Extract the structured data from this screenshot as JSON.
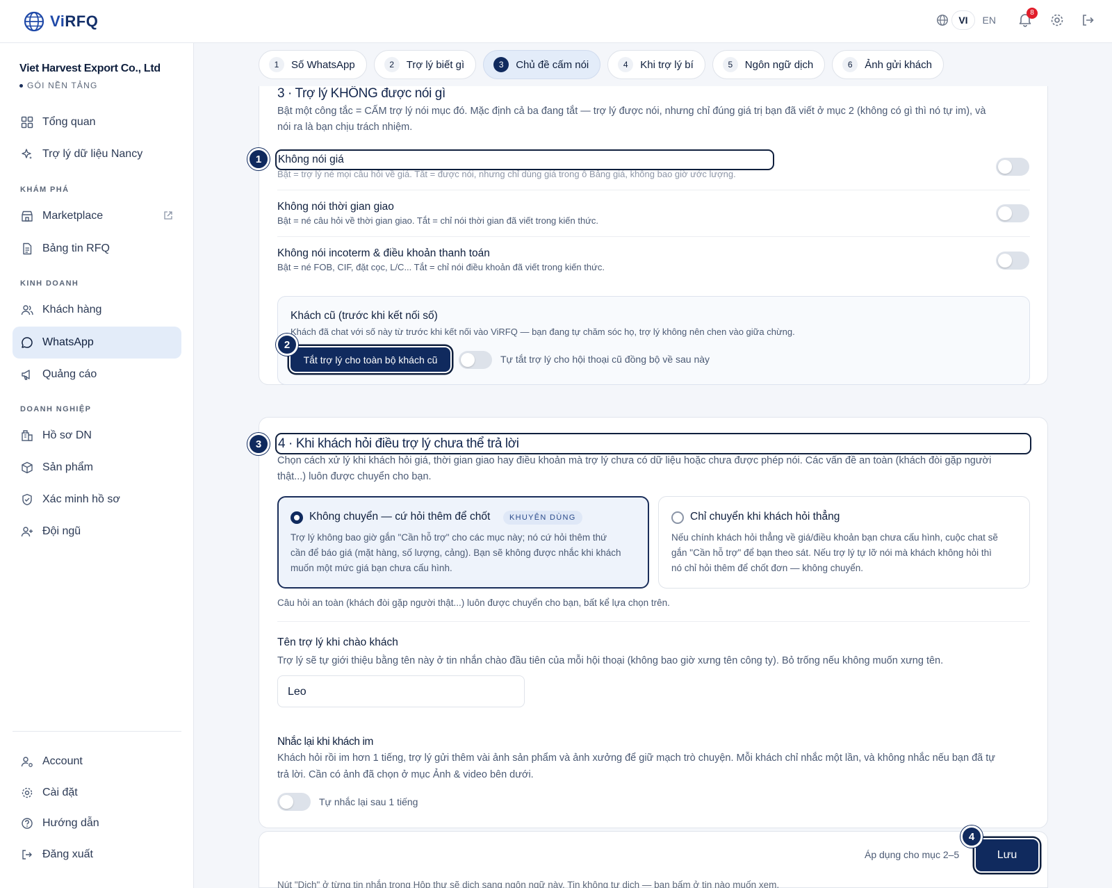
{
  "app": {
    "logo_text": "ViRFQ",
    "logo_accent": "Vi",
    "logo_rest": "RFQ"
  },
  "topbar": {
    "lang_vi": "VI",
    "lang_en": "EN",
    "notifications_count": "8"
  },
  "sidebar": {
    "company": "Viet Harvest Export Co., Ltd",
    "plan": "GÓI NỀN TẢNG",
    "items": [
      {
        "label": "Tổng quan"
      },
      {
        "label": "Trợ lý dữ liệu Nancy"
      },
      {
        "label": "Marketplace"
      },
      {
        "label": "Bảng tin RFQ"
      },
      {
        "label": "Khách hàng"
      },
      {
        "label": "WhatsApp"
      },
      {
        "label": "Quảng cáo"
      },
      {
        "label": "Hồ sơ DN"
      },
      {
        "label": "Sản phẩm"
      },
      {
        "label": "Xác minh hồ sơ"
      },
      {
        "label": "Đội ngũ"
      }
    ],
    "sections": {
      "explore": "KHÁM PHÁ",
      "business": "KINH DOANH",
      "enterprise": "DOANH NGHIỆP"
    },
    "bottom": [
      {
        "label": "Account"
      },
      {
        "label": "Cài đặt"
      },
      {
        "label": "Hướng dẫn"
      },
      {
        "label": "Đăng xuất"
      }
    ]
  },
  "tabs": [
    {
      "num": "1",
      "label": "Số WhatsApp"
    },
    {
      "num": "2",
      "label": "Trợ lý biết gì"
    },
    {
      "num": "3",
      "label": "Chủ đề cấm nói"
    },
    {
      "num": "4",
      "label": "Khi trợ lý bí"
    },
    {
      "num": "5",
      "label": "Ngôn ngữ dịch"
    },
    {
      "num": "6",
      "label": "Ảnh gửi khách"
    }
  ],
  "section3": {
    "title": "3 · Trợ lý KHÔNG được nói gì",
    "desc_line1": "Bật một công tắc = CẤM trợ lý nói mục đó. Mặc định cả ba đang tắt — trợ lý được nói, nhưng chỉ đúng giá trị bạn đã viết ở mục 2 (không có gì thì nó tự im), và",
    "desc_line2": "nói ra là bạn chịu trách nhiệm.",
    "rows": [
      {
        "title": "Không nói giá",
        "sub": "Bật = trợ lý né mọi câu hỏi về giá. Tắt = được nói, nhưng chỉ dùng giá trong ô Bảng giá, không bao giờ ước lượng."
      },
      {
        "title": "Không nói thời gian giao",
        "sub": "Bật = né câu hỏi về thời gian giao. Tắt = chỉ nói thời gian đã viết trong kiến thức."
      },
      {
        "title": "Không nói incoterm & điều khoản thanh toán",
        "sub": "Bật = né FOB, CIF, đặt cọc, L/C... Tắt = chỉ nói điều khoản đã viết trong kiến thức."
      }
    ],
    "old_customers": {
      "title": "Khách cũ (trước khi kết nối số)",
      "desc": "Khách đã chat với số này từ trước khi kết nối vào ViRFQ — bạn đang tự chăm sóc họ, trợ lý không nên chen vào giữa chừng.",
      "button": "Tắt trợ lý cho toàn bộ khách cũ",
      "toggle_label": "Tự tắt trợ lý cho hội thoại cũ đồng bộ về sau này"
    }
  },
  "section4": {
    "title": "4 · Khi khách hỏi điều trợ lý chưa thể trả lời",
    "desc_line1": "Chọn cách xử lý khi khách hỏi giá, thời gian giao hay điều khoản mà trợ lý chưa có dữ liệu hoặc chưa được phép nói. Các vấn đề an toàn (khách đòi gặp người",
    "desc_line2": "thật...) luôn được chuyển cho bạn.",
    "option1": {
      "title": "Không chuyển — cứ hỏi thêm để chốt",
      "badge": "KHUYÊN DÙNG",
      "desc_line1": "Trợ lý không bao giờ gắn \"Cần hỗ trợ\" cho các mục này; nó cứ hỏi thêm thứ",
      "desc_line2": "cần để báo giá (mặt hàng, số lượng, cảng). Bạn sẽ không được nhắc khi khách",
      "desc_line3": "muốn một mức giá bạn chưa cấu hình."
    },
    "option2": {
      "title": "Chỉ chuyển khi khách hỏi thẳng",
      "desc_line1": "Nếu chính khách hỏi thẳng về giá/điều khoản bạn chưa cấu hình, cuộc chat sẽ",
      "desc_line2": "gắn \"Cần hỗ trợ\" để bạn theo sát. Nếu trợ lý tự lỡ nói mà khách không hỏi thì",
      "desc_line3": "nó chỉ hỏi thêm để chốt đơn — không chuyển."
    },
    "note": "Câu hỏi an toàn (khách đòi gặp người thật...) luôn được chuyển cho bạn, bất kể lựa chọn trên.",
    "assistant_name": {
      "title": "Tên trợ lý khi chào khách",
      "desc": "Trợ lý sẽ tự giới thiệu bằng tên này ở tin nhắn chào đầu tiên của mỗi hội thoại (không bao giờ xưng tên công ty). Bỏ trống nếu không muốn xưng tên.",
      "value": "Leo"
    },
    "reminder": {
      "title": "Nhắc lại khi khách im",
      "desc_line1": "Khách hỏi rồi im hơn 1 tiếng, trợ lý gửi thêm vài ảnh sản phẩm và ảnh xưởng để giữ mạch trò chuyện. Mỗi khách chỉ nhắc một lần, và không nhắc nếu bạn đã tự",
      "desc_line2": "trả lời. Cần có ảnh đã chọn ở mục Ảnh & video bên dưới.",
      "toggle_label": "Tự nhắc lại sau 1 tiếng"
    }
  },
  "save_bar": {
    "apply_text": "Áp dụng cho mục 2–5",
    "save": "Lưu"
  },
  "bottom_peek": "Nút \"Dịch\" ở từng tin nhắn trong Hộp thư sẽ dịch sang ngôn ngữ này. Tin không tự dịch — bạn bấm ở tin nào muốn xem.",
  "markers": [
    "1",
    "2",
    "3",
    "4"
  ],
  "colors": {
    "navy": "#102a5e",
    "active_bg": "#e3ecf9",
    "badge_red": "#e11d2a"
  }
}
